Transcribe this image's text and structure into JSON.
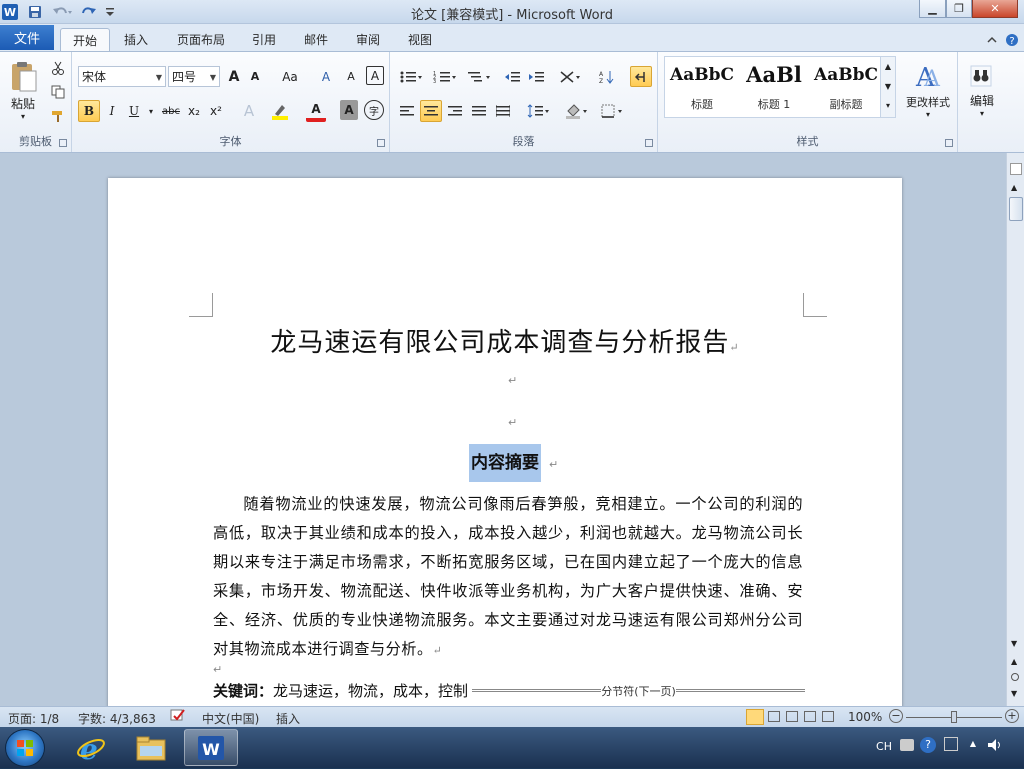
{
  "window": {
    "title": "论文 [兼容模式] - Microsoft Word",
    "app_icon": "W",
    "min_label": "▁",
    "max_label": "❐",
    "close_label": "✕"
  },
  "tabs": {
    "file": "文件",
    "items": [
      "开始",
      "插入",
      "页面布局",
      "引用",
      "邮件",
      "审阅",
      "视图"
    ],
    "active": "开始"
  },
  "ribbon": {
    "clipboard": {
      "label": "剪贴板",
      "paste": "粘贴"
    },
    "font": {
      "label": "字体",
      "font_name": "宋体",
      "font_size": "四号",
      "grow": "A",
      "shrink": "A",
      "change_case": "Aa",
      "bold": "B",
      "italic": "I",
      "underline": "U",
      "strikethrough": "abc",
      "subscript": "x₂",
      "superscript": "x²",
      "font_color": "A",
      "char_shading": "A",
      "enclose": "字",
      "text_effects": "A",
      "clear_format": "A",
      "phonetic": "A",
      "char_border": "A"
    },
    "paragraph": {
      "label": "段落"
    },
    "styles": {
      "label": "样式",
      "items": [
        {
          "sample": "AaBbC",
          "name": "标题"
        },
        {
          "sample": "AaBl",
          "name": "标题 1"
        },
        {
          "sample": "AaBbC",
          "name": "副标题"
        }
      ],
      "change_styles": "更改样式"
    },
    "editing": {
      "label": "编辑"
    }
  },
  "document": {
    "title": "龙马速运有限公司成本调查与分析报告",
    "para_mark": "↵",
    "abstract_heading": "内容摘要",
    "abstract": "随着物流业的快速发展，物流公司像雨后春笋般，竞相建立。一个公司的利润的高低，取决于其业绩和成本的投入，成本投入越少，利润也就越大。龙马物流公司长期以来专注于满足市场需求，不断拓宽服务区域，已在国内建立起了一个庞大的信息采集，市场开发、物流配送、快件收派等业务机构，为广大客户提供快速、准确、安全、经济、优质的专业快递物流服务。本文主要通过对龙马速运有限公司郑州分公司对其物流成本进行调查与分析。",
    "keywords_label": "关键词：",
    "keywords": "龙马速运，物流，成本，控制",
    "section_break": "分节符(下一页)"
  },
  "status": {
    "page": "页面: 1/8",
    "words": "字数: 4/3,863",
    "language": "中文(中国)",
    "mode": "插入",
    "zoom": "100%",
    "zoom_fraction": 0.5
  },
  "taskbar": {
    "ime": "CH",
    "apps": [
      "internet-explorer",
      "file-explorer",
      "microsoft-word"
    ]
  }
}
